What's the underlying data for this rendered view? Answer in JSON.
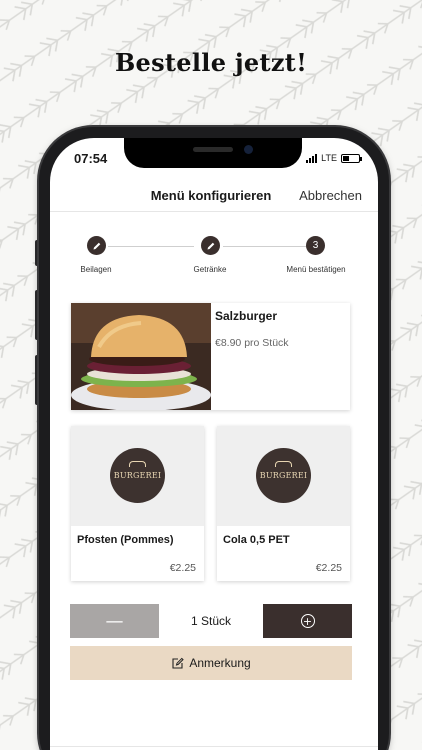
{
  "headline": "Bestelle jetzt!",
  "status_bar": {
    "time": "07:54",
    "network": "LTE"
  },
  "navbar": {
    "title": "Menü konfigurieren",
    "cancel_label": "Abbrechen"
  },
  "stepper": {
    "steps": [
      {
        "label": "Beilagen",
        "state": "done",
        "icon": "pencil-icon"
      },
      {
        "label": "Getränke",
        "state": "done",
        "icon": "pencil-icon"
      },
      {
        "label": "Menü bestätigen",
        "state": "current",
        "number": "3"
      }
    ]
  },
  "product": {
    "name": "Salzburger",
    "price": "€8.90 pro Stück"
  },
  "menu_items": [
    {
      "name": "Pfosten (Pommes)",
      "price": "€2.25",
      "logo_text": "BURGEREI"
    },
    {
      "name": "Cola 0,5 PET",
      "price": "€2.25",
      "logo_text": "BURGEREI"
    }
  ],
  "quantity": {
    "value": "1 Stück",
    "minus_icon": "minus-icon",
    "plus_icon": "plus-circle-icon"
  },
  "note_button": {
    "label": "Anmerkung",
    "icon": "edit-note-icon"
  },
  "colors": {
    "brand_dark": "#3a2f2d",
    "accent_beige": "#ead9c4",
    "disabled_gray": "#a9a6a5"
  }
}
